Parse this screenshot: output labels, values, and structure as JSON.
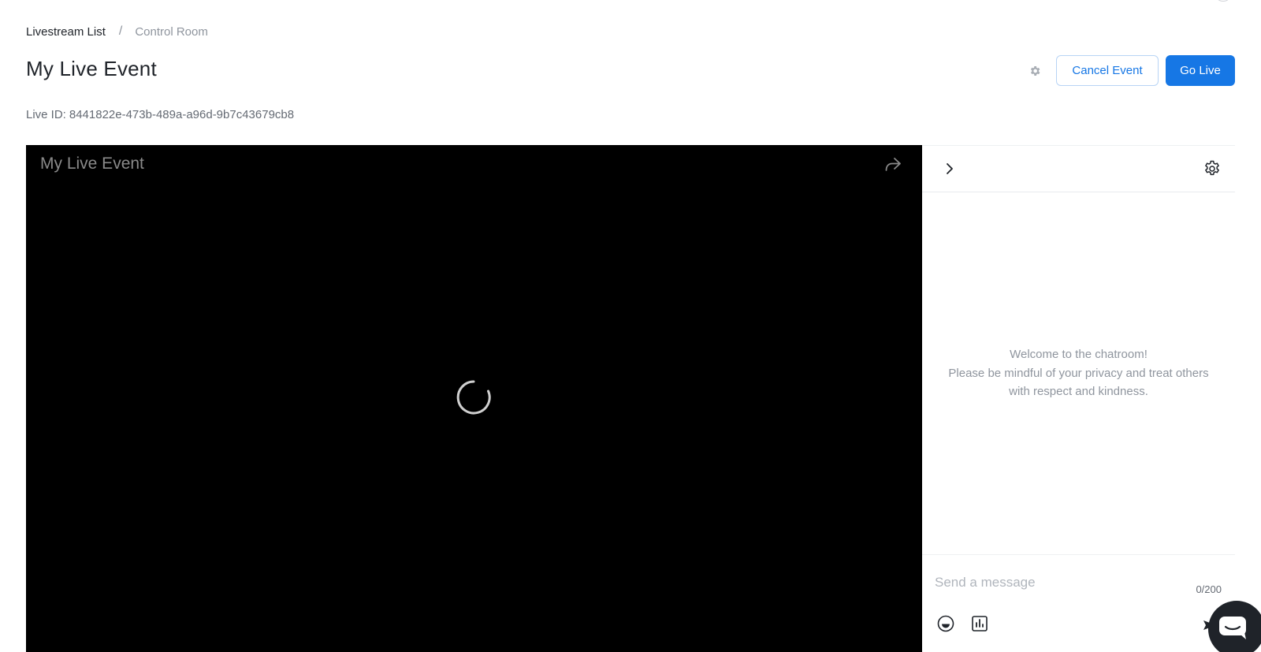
{
  "breadcrumb": {
    "parent": "Livestream List",
    "separator": "/",
    "current": "Control Room"
  },
  "header": {
    "title": "My Live Event",
    "cancel_label": "Cancel Event",
    "go_live_label": "Go Live"
  },
  "live_id": {
    "label": "Live ID:",
    "value": "8441822e-473b-489a-a96d-9b7c43679cb8"
  },
  "player": {
    "title": "My Live Event",
    "state": "loading"
  },
  "chat": {
    "welcome_line1": "Welcome to the chatroom!",
    "welcome_line2": "Please be mindful of your privacy and treat others",
    "welcome_line3": "with respect and kindness.",
    "input_placeholder": "Send a message",
    "input_value": "",
    "counter": "0/200"
  },
  "icons": {
    "header_settings": "gear-icon",
    "share": "share-icon",
    "collapse": "chevron-right-icon",
    "chat_settings": "gear-icon",
    "emoji": "emoji-icon",
    "poll": "bar-chart-icon",
    "send": "send-icon",
    "support": "chat-bubble-icon"
  },
  "colors": {
    "primary": "#1677e5",
    "video_bg": "#000000",
    "muted_text": "#8f959e"
  }
}
